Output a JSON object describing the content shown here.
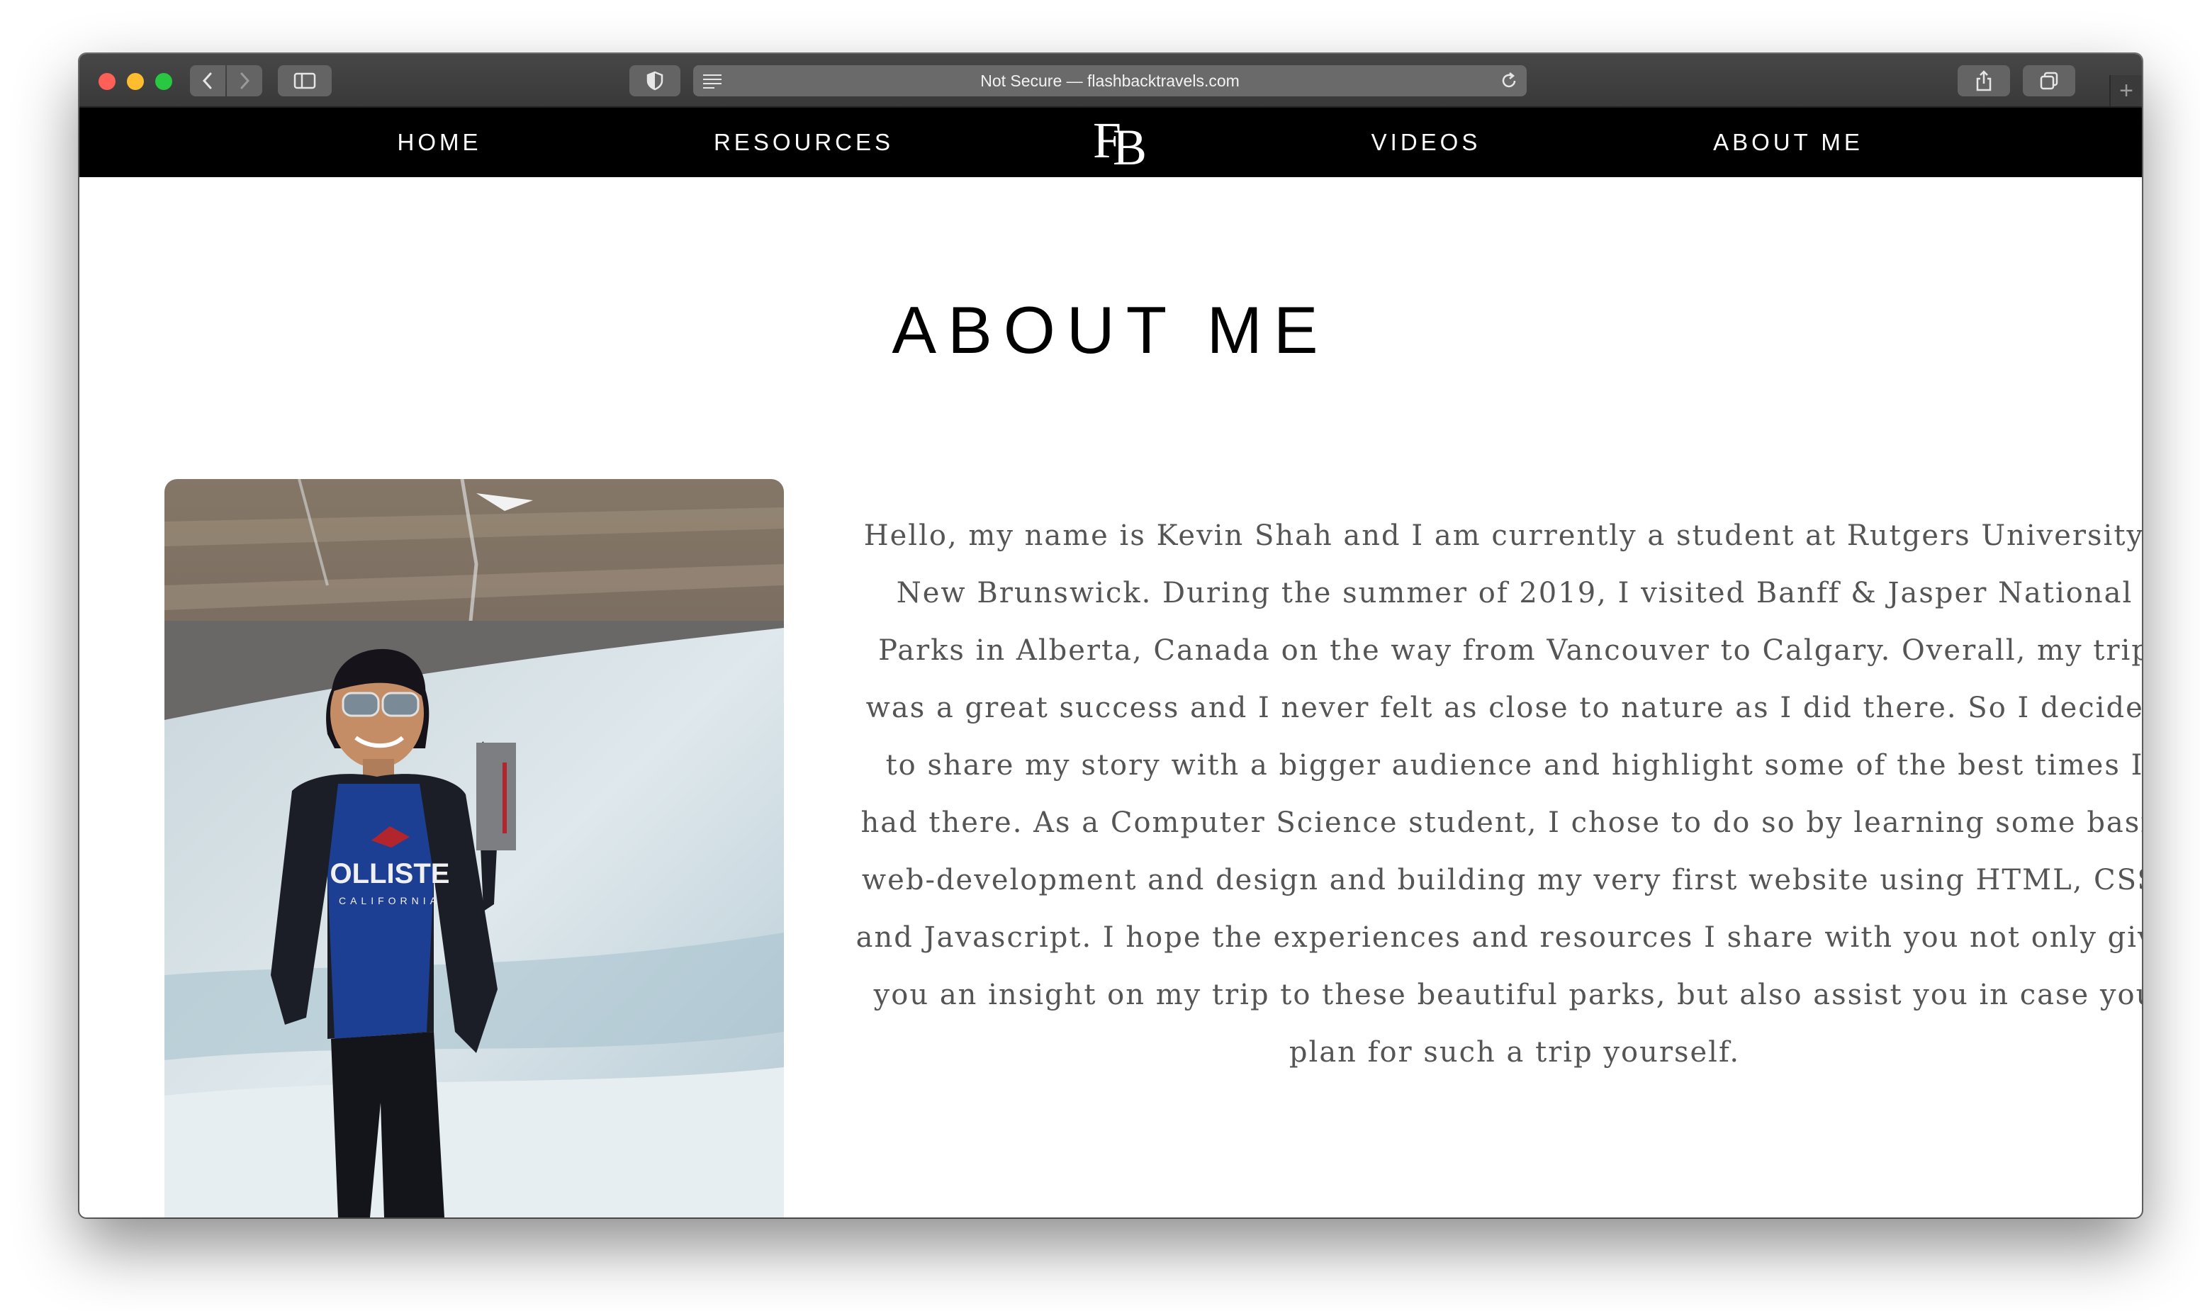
{
  "browser": {
    "address": "Not Secure — flashbacktravels.com",
    "icons": [
      "back-icon",
      "forward-icon",
      "sidebar-icon",
      "shield-icon",
      "reader-icon",
      "reload-icon",
      "share-icon",
      "tabs-icon",
      "plus-icon"
    ],
    "new_tab_symbol": "+"
  },
  "site": {
    "nav": {
      "home": "HOME",
      "resources": "RESOURCES",
      "videos": "VIDEOS",
      "about": "ABOUT ME",
      "logo_f": "F",
      "logo_b": "B"
    },
    "title": "ABOUT ME",
    "bio": "Hello, my name is Kevin Shah and I am currently a student at Rutgers University - New Brunswick. During the summer of 2019, I visited Banff & Jasper National Parks in Alberta, Canada on the way from Vancouver to Calgary. Overall, my trip was a great success and I never felt as close to nature as I did there. So I decided to share my story with a bigger audience and highlight some of the best times I had there. As a Computer Science student, I chose to do so by learning some basic web-development and design and building my very first website using HTML, CSS, and Javascript. I hope the experiences and resources I share with you not only give you an insight on my trip to these beautiful parks, but also assist you in case you plan for such a trip yourself.",
    "photo_shirt_text": "OLLISTE",
    "photo_shirt_subtext": "CALIFORNIA"
  },
  "colors": {
    "nav_bg": "#000000",
    "nav_text": "#ffffff",
    "bio_text": "#555555",
    "title_text": "#000000"
  }
}
